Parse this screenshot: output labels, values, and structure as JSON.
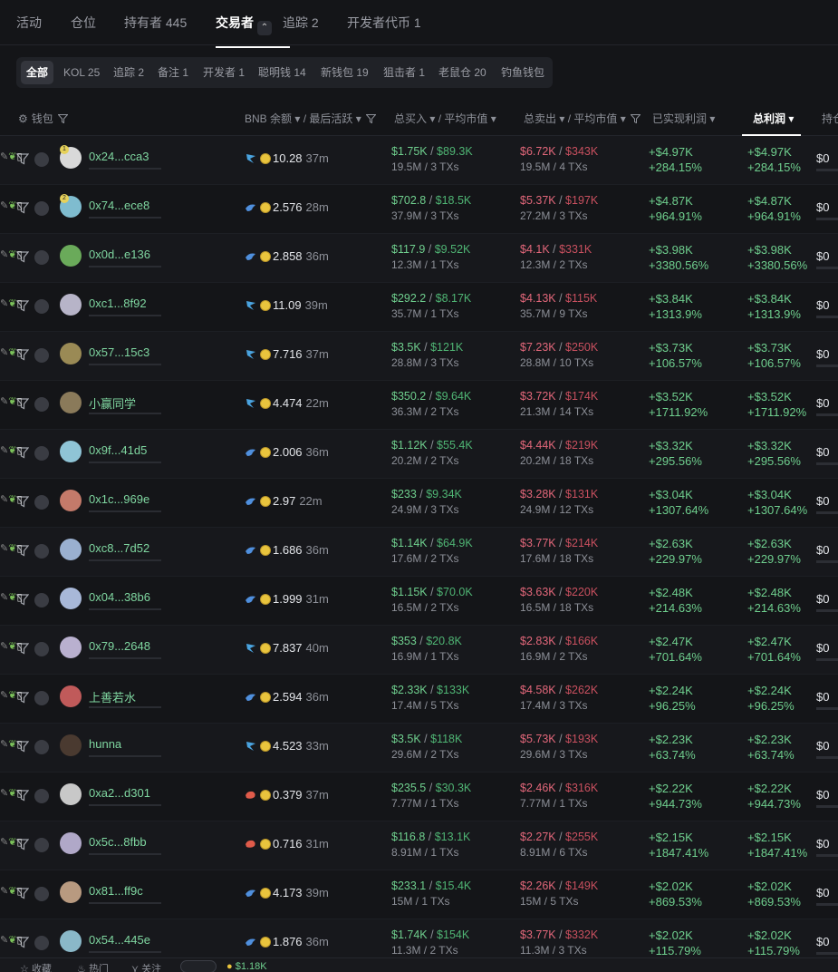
{
  "top_tabs": [
    {
      "label": "活动"
    },
    {
      "label": "仓位"
    },
    {
      "label": "持有者 445"
    },
    {
      "label": "交易者"
    },
    {
      "label": "追踪 2"
    },
    {
      "label": "开发者代币 1"
    }
  ],
  "filter_pills": [
    {
      "label": "全部"
    },
    {
      "label": "KOL 25"
    },
    {
      "label": "追踪 2"
    },
    {
      "label": "备注 1"
    },
    {
      "label": "开发者 1"
    },
    {
      "label": "聪明钱 14"
    },
    {
      "label": "新钱包 19"
    },
    {
      "label": "狙击者 1"
    },
    {
      "label": "老鼠仓 20"
    },
    {
      "label": "钓鱼钱包"
    }
  ],
  "columns": {
    "wallet": "钱包",
    "balance": "BNB 余额 ▾ / 最后活跃 ▾",
    "bought": "总买入 ▾ / 平均市值 ▾",
    "sold": "总卖出 ▾ / 平均市值 ▾",
    "realized": "已实现利润 ▾",
    "total": "总利润 ▾",
    "holding": "持仓"
  },
  "rows": [
    {
      "name": "0x24...cca3",
      "badge": "1",
      "tag": "blue",
      "bal": "10.28",
      "time": "37m",
      "buy": "$1.75K",
      "buy_mc": "$89.3K",
      "buy_sub": "19.5M / 3 TXs",
      "sell": "$6.72K",
      "sell_mc": "$343K",
      "sell_sub": "19.5M / 4 TXs",
      "pnl": "+$4.97K",
      "pct": "+284.15%",
      "tpnl": "+$4.97K",
      "tpct": "+284.15%",
      "hold": "$0",
      "av": "#d9d9d9"
    },
    {
      "name": "0x74...ece8",
      "badge": "2",
      "tag": "bird",
      "bal": "2.576",
      "time": "28m",
      "buy": "$702.8",
      "buy_mc": "$18.5K",
      "buy_sub": "37.9M / 3 TXs",
      "sell": "$5.37K",
      "sell_mc": "$197K",
      "sell_sub": "27.2M / 3 TXs",
      "pnl": "+$4.87K",
      "pct": "+964.91%",
      "tpnl": "+$4.87K",
      "tpct": "+964.91%",
      "hold": "$0",
      "av": "#7fbccf"
    },
    {
      "name": "0x0d...e136",
      "badge": "",
      "tag": "bird",
      "bal": "2.858",
      "time": "36m",
      "buy": "$117.9",
      "buy_mc": "$9.52K",
      "buy_sub": "12.3M / 1 TXs",
      "sell": "$4.1K",
      "sell_mc": "$331K",
      "sell_sub": "12.3M / 2 TXs",
      "pnl": "+$3.98K",
      "pct": "+3380.56%",
      "tpnl": "+$3.98K",
      "tpct": "+3380.56%",
      "hold": "$0",
      "av": "#6aaa5a"
    },
    {
      "name": "0xc1...8f92",
      "badge": "",
      "tag": "blue",
      "bal": "11.09",
      "time": "39m",
      "buy": "$292.2",
      "buy_mc": "$8.17K",
      "buy_sub": "35.7M / 1 TXs",
      "sell": "$4.13K",
      "sell_mc": "$115K",
      "sell_sub": "35.7M / 9 TXs",
      "pnl": "+$3.84K",
      "pct": "+1313.9%",
      "tpnl": "+$3.84K",
      "tpct": "+1313.9%",
      "hold": "$0",
      "av": "#b7b4c8"
    },
    {
      "name": "0x57...15c3",
      "badge": "",
      "tag": "blue",
      "bal": "7.716",
      "time": "37m",
      "buy": "$3.5K",
      "buy_mc": "$121K",
      "buy_sub": "28.8M / 3 TXs",
      "sell": "$7.23K",
      "sell_mc": "$250K",
      "sell_sub": "28.8M / 10 TXs",
      "pnl": "+$3.73K",
      "pct": "+106.57%",
      "tpnl": "+$3.73K",
      "tpct": "+106.57%",
      "hold": "$0",
      "av": "#9a8a55"
    },
    {
      "name": "小赢同学",
      "badge": "",
      "tag": "blue",
      "bal": "4.474",
      "time": "22m",
      "buy": "$350.2",
      "buy_mc": "$9.64K",
      "buy_sub": "36.3M / 2 TXs",
      "sell": "$3.72K",
      "sell_mc": "$174K",
      "sell_sub": "21.3M / 14 TXs",
      "pnl": "+$3.52K",
      "pct": "+1711.92%",
      "tpnl": "+$3.52K",
      "tpct": "+1711.92%",
      "hold": "$0",
      "av": "#8a7a5a"
    },
    {
      "name": "0x9f...41d5",
      "badge": "",
      "tag": "bird",
      "bal": "2.006",
      "time": "36m",
      "buy": "$1.12K",
      "buy_mc": "$55.4K",
      "buy_sub": "20.2M / 2 TXs",
      "sell": "$4.44K",
      "sell_mc": "$219K",
      "sell_sub": "20.2M / 18 TXs",
      "pnl": "+$3.32K",
      "pct": "+295.56%",
      "tpnl": "+$3.32K",
      "tpct": "+295.56%",
      "hold": "$0",
      "av": "#8fc4d6"
    },
    {
      "name": "0x1c...969e",
      "badge": "",
      "tag": "bird",
      "bal": "2.97",
      "time": "22m",
      "buy": "$233",
      "buy_mc": "$9.34K",
      "buy_sub": "24.9M / 3 TXs",
      "sell": "$3.28K",
      "sell_mc": "$131K",
      "sell_sub": "24.9M / 12 TXs",
      "pnl": "+$3.04K",
      "pct": "+1307.64%",
      "tpnl": "+$3.04K",
      "tpct": "+1307.64%",
      "hold": "$0",
      "av": "#c47a6a"
    },
    {
      "name": "0xc8...7d52",
      "badge": "",
      "tag": "bird",
      "bal": "1.686",
      "time": "36m",
      "buy": "$1.14K",
      "buy_mc": "$64.9K",
      "buy_sub": "17.6M / 2 TXs",
      "sell": "$3.77K",
      "sell_mc": "$214K",
      "sell_sub": "17.6M / 18 TXs",
      "pnl": "+$2.63K",
      "pct": "+229.97%",
      "tpnl": "+$2.63K",
      "tpct": "+229.97%",
      "hold": "$0",
      "av": "#9ab0d0"
    },
    {
      "name": "0x04...38b6",
      "badge": "",
      "tag": "bird",
      "bal": "1.999",
      "time": "31m",
      "buy": "$1.15K",
      "buy_mc": "$70.0K",
      "buy_sub": "16.5M / 2 TXs",
      "sell": "$3.63K",
      "sell_mc": "$220K",
      "sell_sub": "16.5M / 18 TXs",
      "pnl": "+$2.48K",
      "pct": "+214.63%",
      "tpnl": "+$2.48K",
      "tpct": "+214.63%",
      "hold": "$0",
      "av": "#a8b8d8"
    },
    {
      "name": "0x79...2648",
      "badge": "",
      "tag": "blue",
      "bal": "7.837",
      "time": "40m",
      "buy": "$353",
      "buy_mc": "$20.8K",
      "buy_sub": "16.9M / 1 TXs",
      "sell": "$2.83K",
      "sell_mc": "$166K",
      "sell_sub": "16.9M / 2 TXs",
      "pnl": "+$2.47K",
      "pct": "+701.64%",
      "tpnl": "+$2.47K",
      "tpct": "+701.64%",
      "hold": "$0",
      "av": "#b9b0cf"
    },
    {
      "name": "上善若水",
      "badge": "",
      "tag": "bird",
      "bal": "2.594",
      "time": "36m",
      "buy": "$2.33K",
      "buy_mc": "$133K",
      "buy_sub": "17.4M / 5 TXs",
      "sell": "$4.58K",
      "sell_mc": "$262K",
      "sell_sub": "17.4M / 3 TXs",
      "pnl": "+$2.24K",
      "pct": "+96.25%",
      "tpnl": "+$2.24K",
      "tpct": "+96.25%",
      "hold": "$0",
      "av": "#c05a5a"
    },
    {
      "name": "hunna",
      "badge": "",
      "tag": "blue",
      "bal": "4.523",
      "time": "33m",
      "buy": "$3.5K",
      "buy_mc": "$118K",
      "buy_sub": "29.6M / 2 TXs",
      "sell": "$5.73K",
      "sell_mc": "$193K",
      "sell_sub": "29.6M / 3 TXs",
      "pnl": "+$2.23K",
      "pct": "+63.74%",
      "tpnl": "+$2.23K",
      "tpct": "+63.74%",
      "hold": "$0",
      "av": "#4a3a30"
    },
    {
      "name": "0xa2...d301",
      "badge": "",
      "tag": "red",
      "bal": "0.379",
      "time": "37m",
      "buy": "$235.5",
      "buy_mc": "$30.3K",
      "buy_sub": "7.77M / 1 TXs",
      "sell": "$2.46K",
      "sell_mc": "$316K",
      "sell_sub": "7.77M / 1 TXs",
      "pnl": "+$2.22K",
      "pct": "+944.73%",
      "tpnl": "+$2.22K",
      "tpct": "+944.73%",
      "hold": "$0",
      "av": "#c8c8c8"
    },
    {
      "name": "0x5c...8fbb",
      "badge": "",
      "tag": "red",
      "bal": "0.716",
      "time": "31m",
      "buy": "$116.8",
      "buy_mc": "$13.1K",
      "buy_sub": "8.91M / 1 TXs",
      "sell": "$2.27K",
      "sell_mc": "$255K",
      "sell_sub": "8.91M / 6 TXs",
      "pnl": "+$2.15K",
      "pct": "+1847.41%",
      "tpnl": "+$2.15K",
      "tpct": "+1847.41%",
      "hold": "$0",
      "av": "#b0a8c8"
    },
    {
      "name": "0x81...ff9c",
      "badge": "",
      "tag": "bird",
      "bal": "4.173",
      "time": "39m",
      "buy": "$233.1",
      "buy_mc": "$15.4K",
      "buy_sub": "15M / 1 TXs",
      "sell": "$2.26K",
      "sell_mc": "$149K",
      "sell_sub": "15M / 5 TXs",
      "pnl": "+$2.02K",
      "pct": "+869.53%",
      "tpnl": "+$2.02K",
      "tpct": "+869.53%",
      "hold": "$0",
      "av": "#b89a80"
    },
    {
      "name": "0x54...445e",
      "badge": "",
      "tag": "bird",
      "bal": "1.876",
      "time": "36m",
      "buy": "$1.74K",
      "buy_mc": "$154K",
      "buy_sub": "11.3M / 2 TXs",
      "sell": "$3.77K",
      "sell_mc": "$332K",
      "sell_sub": "11.3M / 3 TXs",
      "pnl": "+$2.02K",
      "pct": "+115.79%",
      "tpnl": "+$2.02K",
      "tpct": "+115.79%",
      "hold": "$0",
      "av": "#8ab8c8"
    }
  ],
  "bottom": {
    "fav": "收藏",
    "hot": "热门",
    "follow": "关注",
    "price": "$1.18K"
  }
}
